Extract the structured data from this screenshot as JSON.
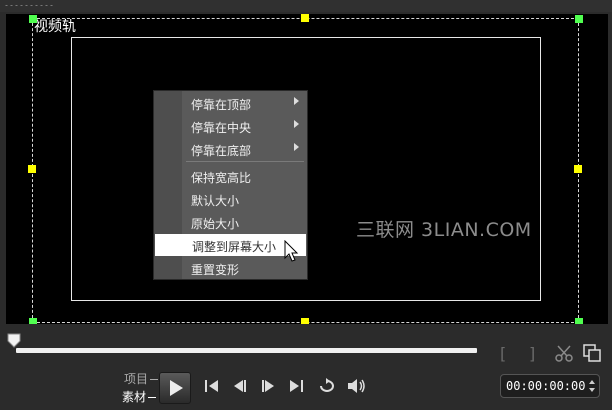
{
  "preview": {
    "track_label": "视频轨",
    "watermark": "三联网 3LIAN.COM"
  },
  "context_menu": {
    "items": [
      {
        "label": "停靠在顶部",
        "submenu": true
      },
      {
        "label": "停靠在中央",
        "submenu": true
      },
      {
        "label": "停靠在底部",
        "submenu": true
      },
      {
        "label": "保持宽高比",
        "submenu": false
      },
      {
        "label": "默认大小",
        "submenu": false
      },
      {
        "label": "原始大小",
        "submenu": false
      },
      {
        "label": "调整到屏幕大小",
        "submenu": false,
        "highlighted": true
      },
      {
        "label": "重置变形",
        "submenu": false
      }
    ]
  },
  "playback": {
    "mode_project": "项目",
    "mode_clip": "素材",
    "active_mode": "素材",
    "position_fraction": 0.0,
    "timecode": "00:00:00:00"
  },
  "icons": [
    "play-icon",
    "go-to-start-icon",
    "previous-frame-icon",
    "next-frame-icon",
    "go-to-end-icon",
    "repeat-icon",
    "volume-icon",
    "mark-in-icon",
    "mark-out-icon",
    "split-scissors-icon",
    "enlarge-preview-icon",
    "timecode-spinner-icon"
  ]
}
